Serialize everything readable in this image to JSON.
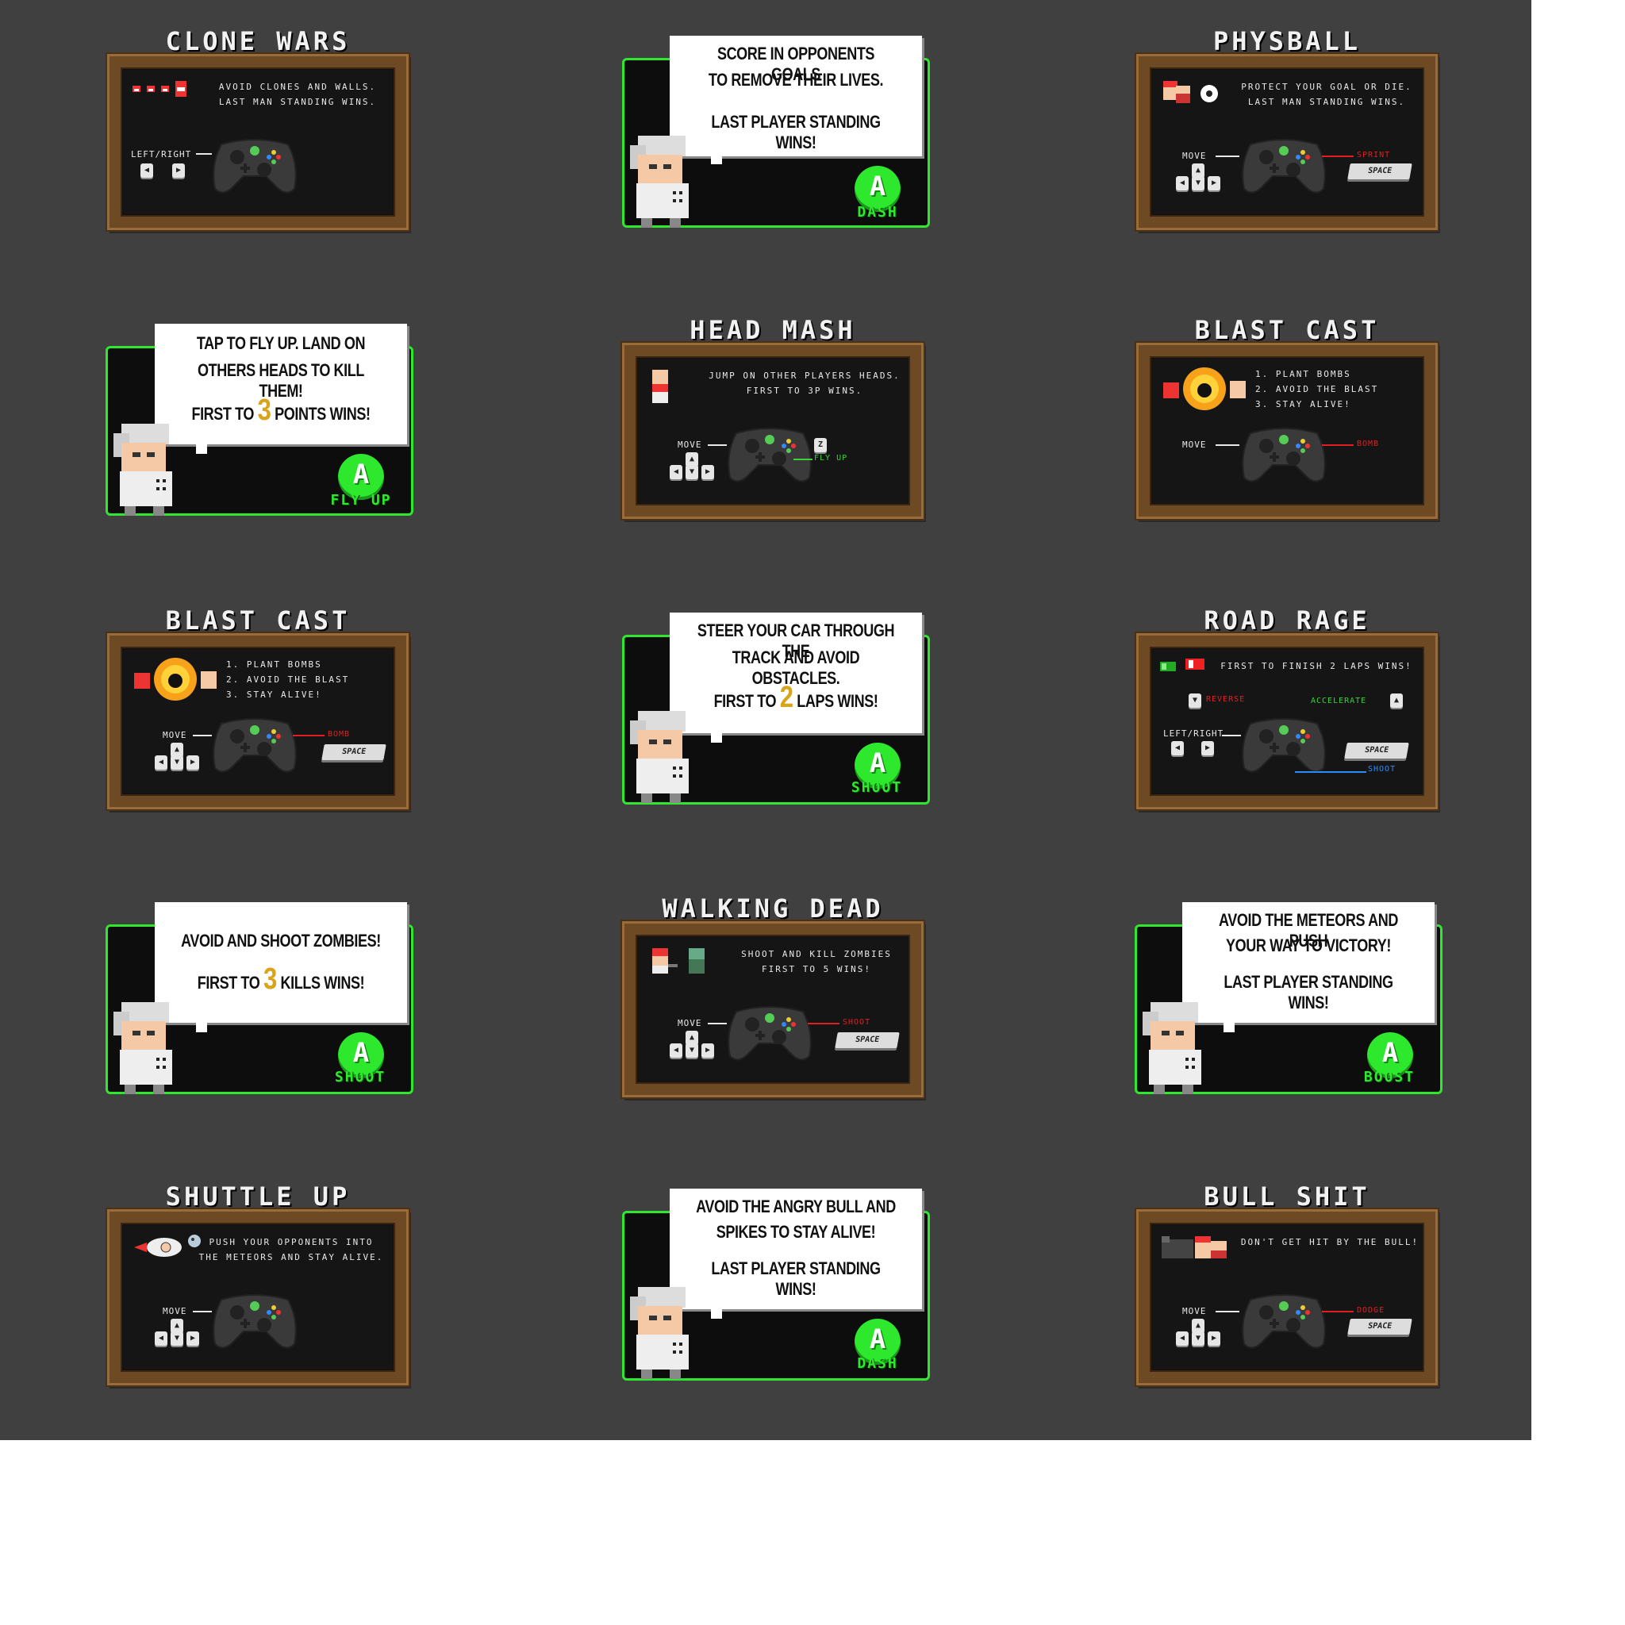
{
  "colors": {
    "background": "#404040",
    "frame": "#6e4a24",
    "board": "#151515",
    "accent_green": "#2ee82e",
    "number_gold": "#d9a31a",
    "red_label": "#e02020",
    "blue_label": "#2a8cff"
  },
  "cards": {
    "clone_wars": {
      "title": "CLONE WARS",
      "desc": "AVOID CLONES AND WALLS.\nLAST MAN STANDING WINS.",
      "control_label": "LEFT/RIGHT"
    },
    "dash_1": {
      "line1": "SCORE IN OPPONENTS GOALS",
      "line2": "TO REMOVE THEIR LIVES.",
      "line3": "LAST PLAYER STANDING WINS!",
      "button_letter": "A",
      "button_label": "DASH"
    },
    "physball": {
      "title": "PHYSBALL",
      "desc": "PROTECT YOUR GOAL OR DIE.\nLAST MAN STANDING WINS.",
      "control_label": "MOVE",
      "action_label": "SPRINT",
      "space_label": "SPACE"
    },
    "fly_up": {
      "line1": "TAP TO FLY UP. LAND ON",
      "line2": "OTHERS HEADS TO KILL THEM!",
      "line3_pre": "FIRST TO",
      "line3_num": "3",
      "line3_post": "POINTS WINS!",
      "button_letter": "A",
      "button_label": "FLY UP"
    },
    "head_mash": {
      "title": "HEAD MASH",
      "desc": "JUMP ON OTHER PLAYERS HEADS.\nFIRST TO 3P WINS.",
      "control_label": "MOVE",
      "action_label": "FLY UP",
      "key_label": "Z"
    },
    "blast_cast_1": {
      "title": "BLAST CAST",
      "desc": "1. PLANT BOMBS\n2. AVOID THE BLAST\n3. STAY ALIVE!",
      "control_label": "MOVE",
      "action_label": "BOMB"
    },
    "blast_cast_2": {
      "title": "BLAST CAST",
      "desc": "1. PLANT BOMBS\n2. AVOID THE BLAST\n3. STAY ALIVE!",
      "control_label": "MOVE",
      "action_label": "BOMB",
      "space_label": "SPACE"
    },
    "shoot_1": {
      "line1": "STEER YOUR CAR THROUGH THE",
      "line2": "TRACK AND AVOID OBSTACLES.",
      "line3_pre": "FIRST TO",
      "line3_num": "2",
      "line3_post": "LAPS WINS!",
      "button_letter": "A",
      "button_label": "SHOOT"
    },
    "road_rage": {
      "title": "ROAD RAGE",
      "desc": "FIRST TO FINISH 2 LAPS WINS!",
      "reverse_label": "REVERSE",
      "accelerate_label": "ACCELERATE",
      "control_label": "LEFT/RIGHT",
      "space_label": "SPACE",
      "shoot_label": "SHOOT"
    },
    "shoot_2": {
      "line1": "AVOID AND SHOOT ZOMBIES!",
      "line2_pre": "FIRST TO",
      "line2_num": "3",
      "line2_post": "KILLS WINS!",
      "button_letter": "A",
      "button_label": "SHOOT"
    },
    "walking_dead": {
      "title": "WALKING DEAD",
      "desc": "SHOOT AND KILL ZOMBIES\nFIRST TO 5 WINS!",
      "control_label": "MOVE",
      "action_label": "SHOOT",
      "space_label": "SPACE"
    },
    "boost": {
      "line1": "AVOID THE METEORS AND PUSH",
      "line2": "YOUR WAY TO VICTORY!",
      "line3": "LAST PLAYER STANDING WINS!",
      "button_letter": "A",
      "button_label": "BOOST"
    },
    "shuttle_up": {
      "title": "SHUTTLE UP",
      "desc": "PUSH YOUR OPPONENTS INTO\nTHE METEORS AND STAY ALIVE.",
      "control_label": "MOVE"
    },
    "dash_2": {
      "line1": "AVOID THE ANGRY BULL AND",
      "line2": "SPIKES TO STAY ALIVE!",
      "line3": "LAST PLAYER STANDING WINS!",
      "button_letter": "A",
      "button_label": "DASH"
    },
    "bull_shit": {
      "title": "BULL SHIT",
      "desc": "DON'T GET HIT BY THE BULL!",
      "control_label": "MOVE",
      "action_label": "DODGE",
      "space_label": "SPACE"
    }
  }
}
